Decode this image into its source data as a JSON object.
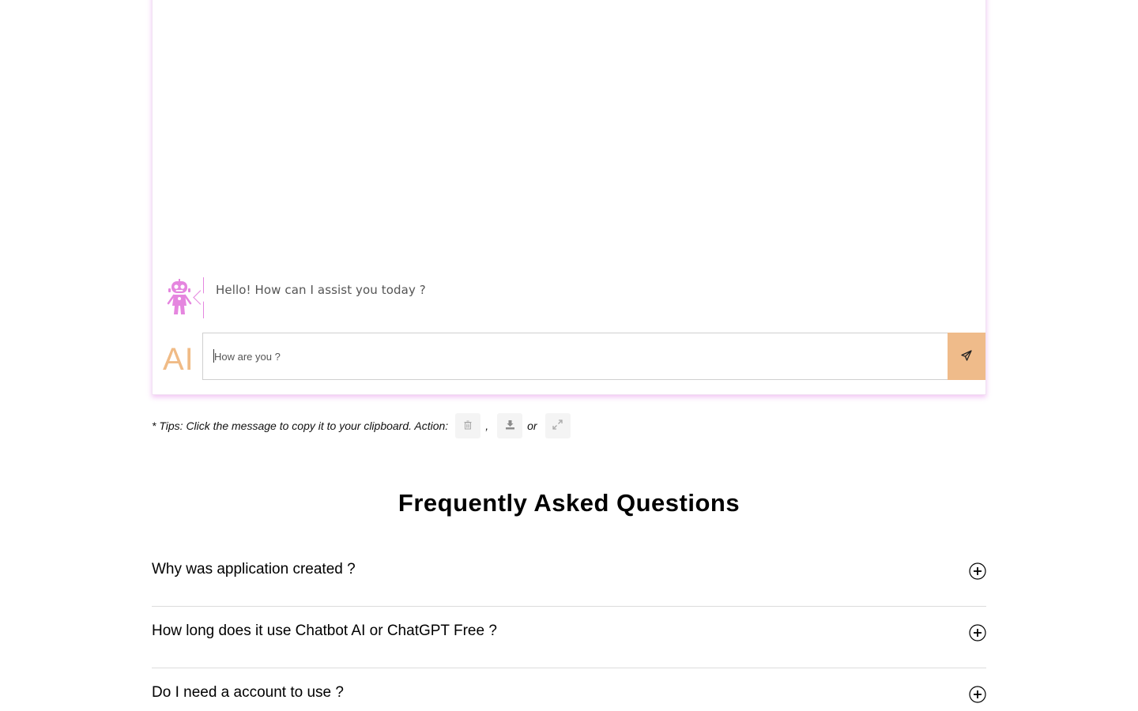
{
  "chat": {
    "bot_message": "Hello! How can I assist you today ?",
    "logo_text": "AI",
    "input_placeholder": "How are you ?",
    "input_value": ""
  },
  "tips": {
    "text": "* Tips: Click the message to copy it to your clipboard. Action:",
    "sep_comma": ",",
    "sep_or": "or",
    "actions": [
      "trash-icon",
      "download-icon",
      "expand-icon"
    ]
  },
  "faq": {
    "title": "Frequently Asked Questions",
    "items": [
      {
        "question": "Why was application created ?"
      },
      {
        "question": "How long does it use Chatbot AI or ChatGPT Free ?"
      },
      {
        "question": "Do I need a account to use ?"
      }
    ]
  },
  "colors": {
    "accent_pink": "#e586df",
    "accent_orange": "#efbb8a",
    "card_shadow": "#e282e6"
  }
}
